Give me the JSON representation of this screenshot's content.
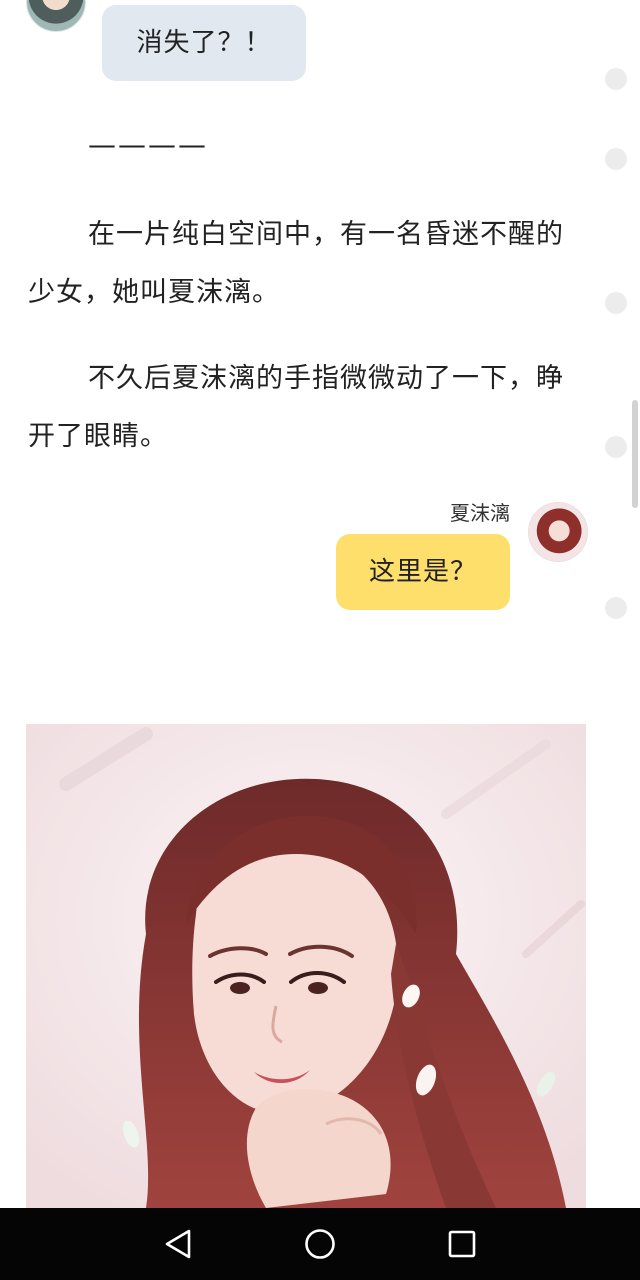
{
  "chat": {
    "incoming_message": "消失了？！",
    "outgoing_speaker": "夏沫漓",
    "outgoing_message": "这里是？"
  },
  "story": {
    "divider": "————",
    "paragraph_1": "在一片纯白空间中，有一名昏迷不醒的少女，她叫夏沫漓。",
    "paragraph_2": "不久后夏沫漓的手指微微动了一下，睁开了眼睛。"
  },
  "colors": {
    "incoming_bubble": "#e1e8f0",
    "outgoing_bubble": "#ffdf6b",
    "nav_bar": "#050505"
  },
  "icons": {
    "nav_back": "triangle-back-icon",
    "nav_home": "circle-home-icon",
    "nav_recent": "square-recent-icon"
  }
}
